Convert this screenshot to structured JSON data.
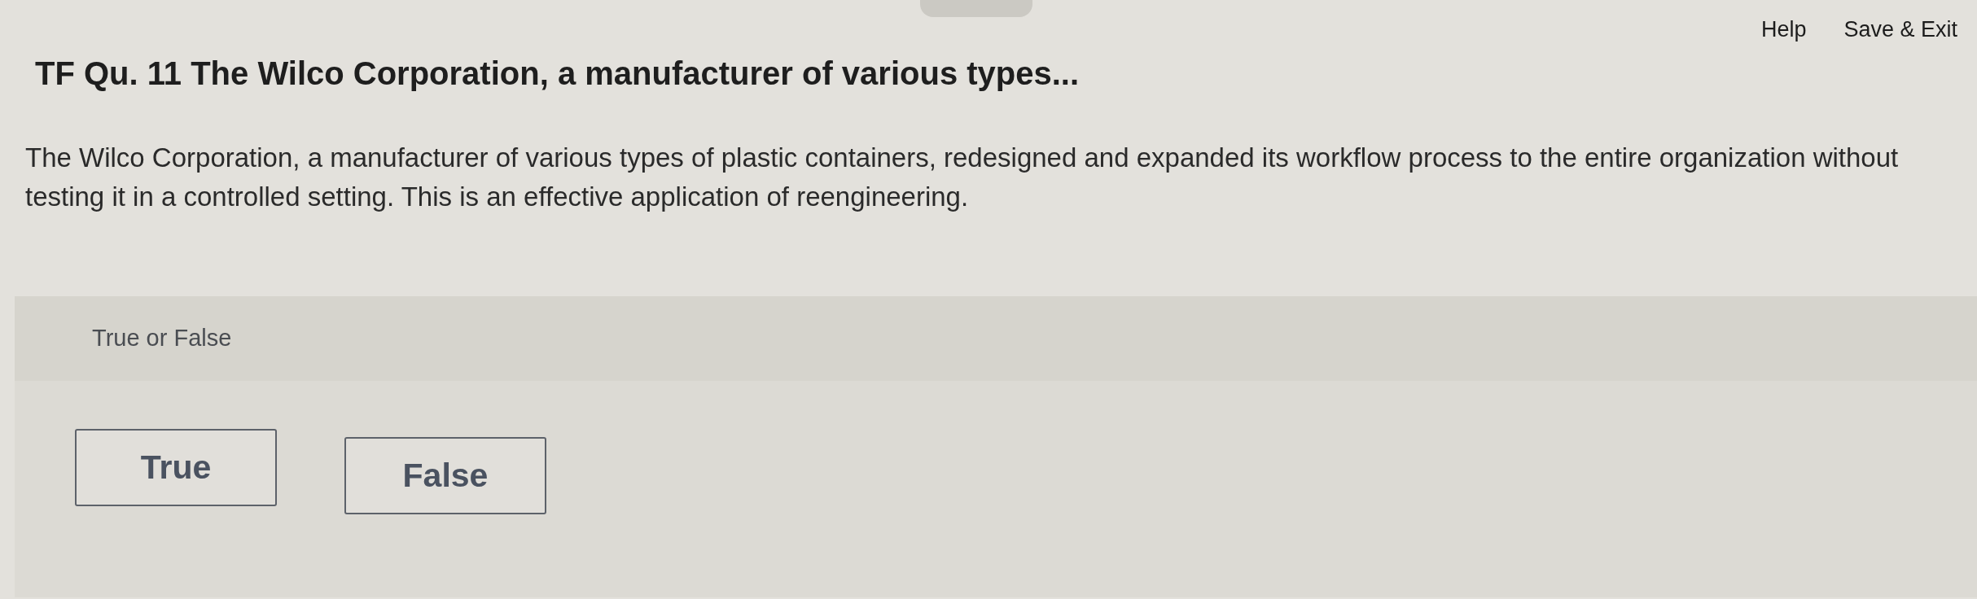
{
  "header": {
    "links": [
      "Help",
      "Save & Exit"
    ]
  },
  "question": {
    "title": "TF Qu. 11 The Wilco Corporation, a manufacturer of various types...",
    "text": "The Wilco Corporation, a manufacturer of various types of plastic containers, redesigned and expanded its workflow process to the entire organization without testing it in a controlled setting. This is an effective application of reengineering.",
    "prompt": "True or False",
    "options": [
      {
        "label": "True",
        "selected": false
      },
      {
        "label": "False",
        "selected": false
      }
    ]
  }
}
